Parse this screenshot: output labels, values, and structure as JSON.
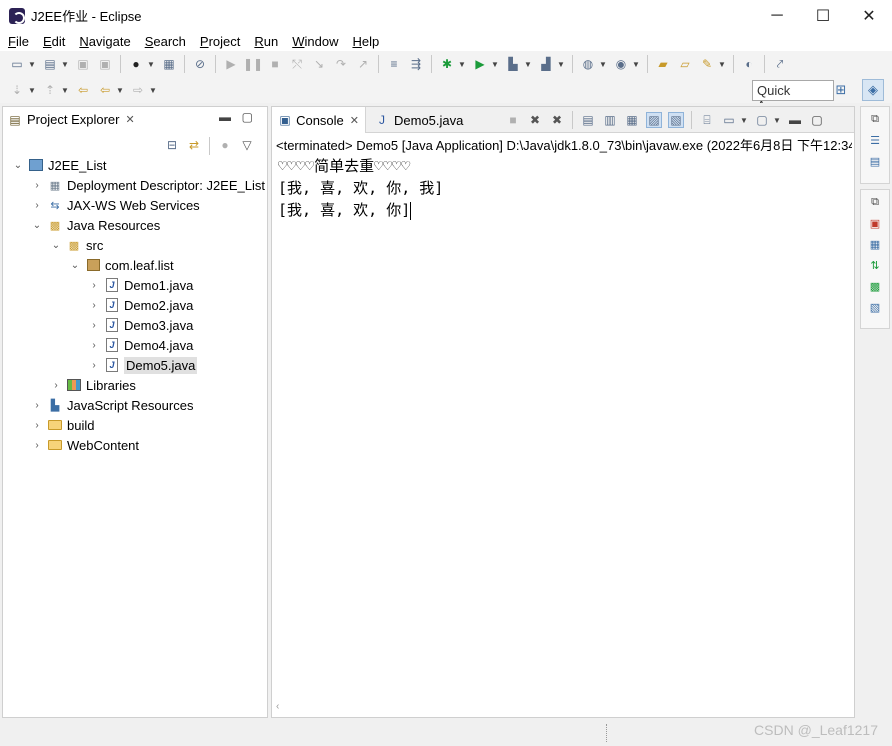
{
  "window": {
    "title": "J2EE作业 - Eclipse",
    "controls": [
      "─",
      "☐",
      "✕"
    ]
  },
  "menu": [
    "File",
    "Edit",
    "Navigate",
    "Search",
    "Project",
    "Run",
    "Window",
    "Help"
  ],
  "toolbar": {
    "quick_access": "Quick Access"
  },
  "explorer": {
    "tab_label": "Project Explorer",
    "tree": [
      {
        "label": "J2EE_List",
        "twisty": "⌄",
        "icon": "proj",
        "indent": 0
      },
      {
        "label": "Deployment Descriptor: J2EE_List",
        "twisty": "›",
        "icon": "dd",
        "indent": 1
      },
      {
        "label": "JAX-WS Web Services",
        "twisty": "›",
        "icon": "ws",
        "indent": 1
      },
      {
        "label": "Java Resources",
        "twisty": "⌄",
        "icon": "jr",
        "indent": 1
      },
      {
        "label": "src",
        "twisty": "⌄",
        "icon": "src",
        "indent": 2
      },
      {
        "label": "com.leaf.list",
        "twisty": "⌄",
        "icon": "pkg",
        "indent": 3
      },
      {
        "label": "Demo1.java",
        "twisty": "›",
        "icon": "jfile",
        "indent": 4
      },
      {
        "label": "Demo2.java",
        "twisty": "›",
        "icon": "jfile",
        "indent": 4
      },
      {
        "label": "Demo3.java",
        "twisty": "›",
        "icon": "jfile",
        "indent": 4
      },
      {
        "label": "Demo4.java",
        "twisty": "›",
        "icon": "jfile",
        "indent": 4
      },
      {
        "label": "Demo5.java",
        "twisty": "›",
        "icon": "jfile",
        "indent": 4,
        "selected": true
      },
      {
        "label": "Libraries",
        "twisty": "›",
        "icon": "lib",
        "indent": 2
      },
      {
        "label": "JavaScript Resources",
        "twisty": "›",
        "icon": "js",
        "indent": 1
      },
      {
        "label": "build",
        "twisty": "›",
        "icon": "folder",
        "indent": 1
      },
      {
        "label": "WebContent",
        "twisty": "›",
        "icon": "folder",
        "indent": 1
      }
    ]
  },
  "console": {
    "tab_label": "Console",
    "editor_tab_label": "Demo5.java",
    "header": "<terminated> Demo5 [Java Application] D:\\Java\\jdk1.8.0_73\\bin\\javaw.exe (2022年6月8日 下午12:34:",
    "lines": [
      "♡♡♡♡简单去重♡♡♡♡",
      "[我, 喜, 欢, 你, 我]",
      "[我, 喜, 欢, 你]"
    ]
  },
  "watermark": "CSDN @_Leaf1217"
}
